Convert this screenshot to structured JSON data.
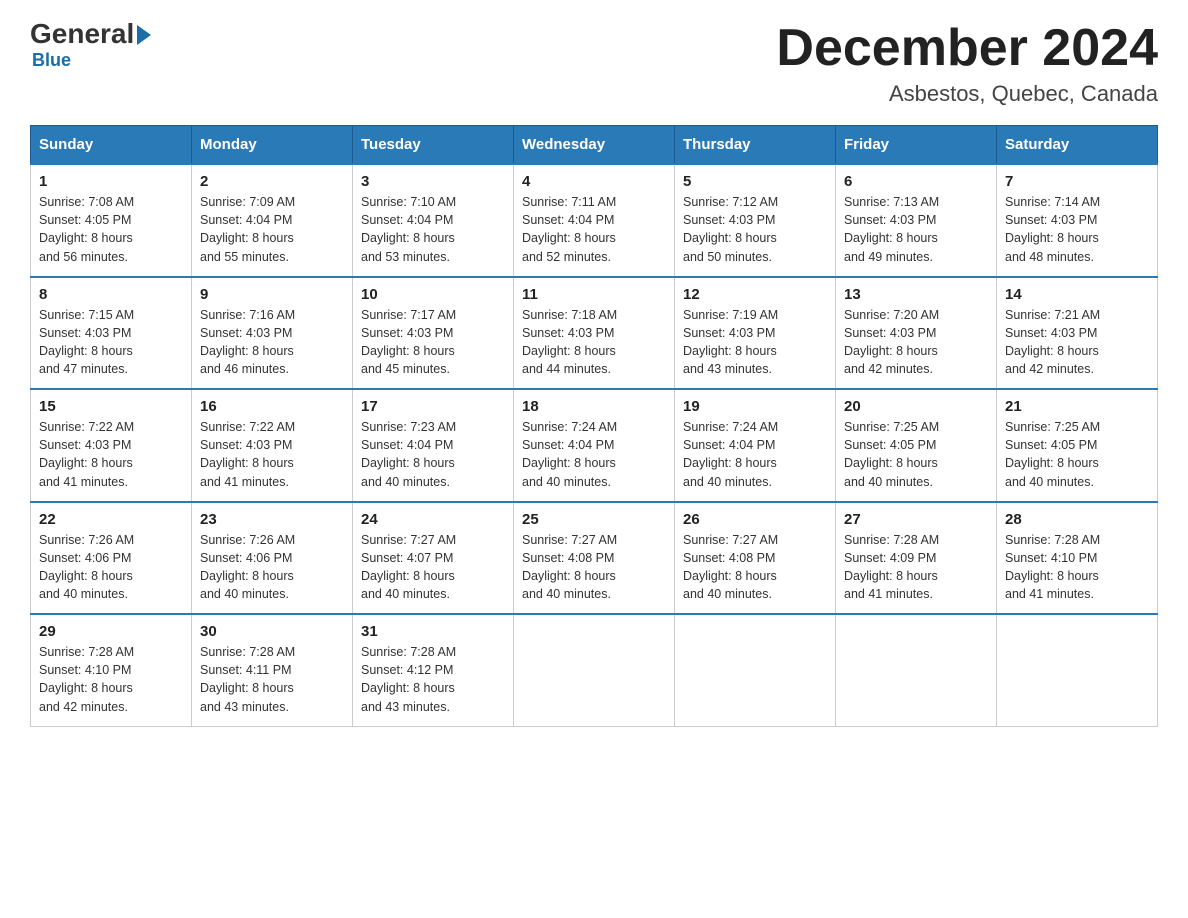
{
  "header": {
    "logo_general": "General",
    "logo_blue": "Blue",
    "month_year": "December 2024",
    "location": "Asbestos, Quebec, Canada"
  },
  "weekdays": [
    "Sunday",
    "Monday",
    "Tuesday",
    "Wednesday",
    "Thursday",
    "Friday",
    "Saturday"
  ],
  "weeks": [
    [
      {
        "day": "1",
        "sunrise": "7:08 AM",
        "sunset": "4:05 PM",
        "daylight": "8 hours and 56 minutes."
      },
      {
        "day": "2",
        "sunrise": "7:09 AM",
        "sunset": "4:04 PM",
        "daylight": "8 hours and 55 minutes."
      },
      {
        "day": "3",
        "sunrise": "7:10 AM",
        "sunset": "4:04 PM",
        "daylight": "8 hours and 53 minutes."
      },
      {
        "day": "4",
        "sunrise": "7:11 AM",
        "sunset": "4:04 PM",
        "daylight": "8 hours and 52 minutes."
      },
      {
        "day": "5",
        "sunrise": "7:12 AM",
        "sunset": "4:03 PM",
        "daylight": "8 hours and 50 minutes."
      },
      {
        "day": "6",
        "sunrise": "7:13 AM",
        "sunset": "4:03 PM",
        "daylight": "8 hours and 49 minutes."
      },
      {
        "day": "7",
        "sunrise": "7:14 AM",
        "sunset": "4:03 PM",
        "daylight": "8 hours and 48 minutes."
      }
    ],
    [
      {
        "day": "8",
        "sunrise": "7:15 AM",
        "sunset": "4:03 PM",
        "daylight": "8 hours and 47 minutes."
      },
      {
        "day": "9",
        "sunrise": "7:16 AM",
        "sunset": "4:03 PM",
        "daylight": "8 hours and 46 minutes."
      },
      {
        "day": "10",
        "sunrise": "7:17 AM",
        "sunset": "4:03 PM",
        "daylight": "8 hours and 45 minutes."
      },
      {
        "day": "11",
        "sunrise": "7:18 AM",
        "sunset": "4:03 PM",
        "daylight": "8 hours and 44 minutes."
      },
      {
        "day": "12",
        "sunrise": "7:19 AM",
        "sunset": "4:03 PM",
        "daylight": "8 hours and 43 minutes."
      },
      {
        "day": "13",
        "sunrise": "7:20 AM",
        "sunset": "4:03 PM",
        "daylight": "8 hours and 42 minutes."
      },
      {
        "day": "14",
        "sunrise": "7:21 AM",
        "sunset": "4:03 PM",
        "daylight": "8 hours and 42 minutes."
      }
    ],
    [
      {
        "day": "15",
        "sunrise": "7:22 AM",
        "sunset": "4:03 PM",
        "daylight": "8 hours and 41 minutes."
      },
      {
        "day": "16",
        "sunrise": "7:22 AM",
        "sunset": "4:03 PM",
        "daylight": "8 hours and 41 minutes."
      },
      {
        "day": "17",
        "sunrise": "7:23 AM",
        "sunset": "4:04 PM",
        "daylight": "8 hours and 40 minutes."
      },
      {
        "day": "18",
        "sunrise": "7:24 AM",
        "sunset": "4:04 PM",
        "daylight": "8 hours and 40 minutes."
      },
      {
        "day": "19",
        "sunrise": "7:24 AM",
        "sunset": "4:04 PM",
        "daylight": "8 hours and 40 minutes."
      },
      {
        "day": "20",
        "sunrise": "7:25 AM",
        "sunset": "4:05 PM",
        "daylight": "8 hours and 40 minutes."
      },
      {
        "day": "21",
        "sunrise": "7:25 AM",
        "sunset": "4:05 PM",
        "daylight": "8 hours and 40 minutes."
      }
    ],
    [
      {
        "day": "22",
        "sunrise": "7:26 AM",
        "sunset": "4:06 PM",
        "daylight": "8 hours and 40 minutes."
      },
      {
        "day": "23",
        "sunrise": "7:26 AM",
        "sunset": "4:06 PM",
        "daylight": "8 hours and 40 minutes."
      },
      {
        "day": "24",
        "sunrise": "7:27 AM",
        "sunset": "4:07 PM",
        "daylight": "8 hours and 40 minutes."
      },
      {
        "day": "25",
        "sunrise": "7:27 AM",
        "sunset": "4:08 PM",
        "daylight": "8 hours and 40 minutes."
      },
      {
        "day": "26",
        "sunrise": "7:27 AM",
        "sunset": "4:08 PM",
        "daylight": "8 hours and 40 minutes."
      },
      {
        "day": "27",
        "sunrise": "7:28 AM",
        "sunset": "4:09 PM",
        "daylight": "8 hours and 41 minutes."
      },
      {
        "day": "28",
        "sunrise": "7:28 AM",
        "sunset": "4:10 PM",
        "daylight": "8 hours and 41 minutes."
      }
    ],
    [
      {
        "day": "29",
        "sunrise": "7:28 AM",
        "sunset": "4:10 PM",
        "daylight": "8 hours and 42 minutes."
      },
      {
        "day": "30",
        "sunrise": "7:28 AM",
        "sunset": "4:11 PM",
        "daylight": "8 hours and 43 minutes."
      },
      {
        "day": "31",
        "sunrise": "7:28 AM",
        "sunset": "4:12 PM",
        "daylight": "8 hours and 43 minutes."
      },
      null,
      null,
      null,
      null
    ]
  ],
  "labels": {
    "sunrise_prefix": "Sunrise: ",
    "sunset_prefix": "Sunset: ",
    "daylight_prefix": "Daylight: "
  }
}
